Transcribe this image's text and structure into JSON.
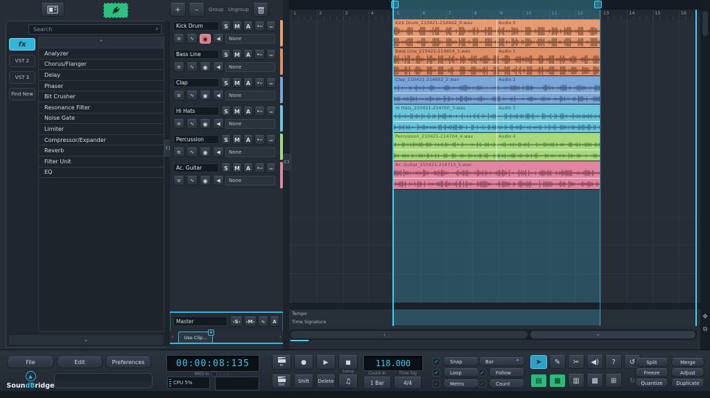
{
  "icons": {
    "search": "⌕",
    "chevron_up": "⌃",
    "chevron_down": "⌄",
    "gutter": "❮❯",
    "record": "●",
    "play": "▶",
    "stop": "■",
    "note": "♫",
    "undo": "↺",
    "redo": "↻",
    "left": "‹",
    "right": "›",
    "move": "✥",
    "copy": "⧉",
    "close": "×",
    "caret_up": "⌃",
    "dots": "•‒",
    "dash": "‒",
    "midi": "≡",
    "wave": "∿",
    "arm": "◉",
    "monitor": "◀",
    "check": "✓",
    "mountain": "▲"
  },
  "browser": {
    "search_placeholder": "Search",
    "tabs": [
      {
        "label": "fx",
        "active": true
      },
      {
        "label": "VST 2",
        "active": false
      },
      {
        "label": "VST 3",
        "active": false
      },
      {
        "label": "Find New",
        "active": false
      }
    ],
    "items": [
      "Analyzer",
      "Chorus/Flanger",
      "Delay",
      "Phaser",
      "Bit Crusher",
      "Resonance Filter",
      "Noise Gate",
      "Limiter",
      "Compressor/Expander",
      "Reverb",
      "Filter Unit",
      "EQ"
    ]
  },
  "tracks": {
    "add": "+",
    "remove": "–",
    "group": "Group",
    "ungroup": "Ungroup",
    "solo": "S",
    "mute": "M",
    "auto": "A",
    "input_value": "None",
    "list": [
      {
        "name": "Kick Drum",
        "color": "#e89a70",
        "armed": true
      },
      {
        "name": "Bass Line",
        "color": "#e08f66",
        "armed": false
      },
      {
        "name": "Clap",
        "color": "#7ca6d8",
        "armed": false
      },
      {
        "name": "Hi Hats",
        "color": "#6cc6de",
        "armed": false
      },
      {
        "name": "Percussion",
        "color": "#a6da7c",
        "armed": false
      },
      {
        "name": "Ac. Guitar",
        "color": "#e286a0",
        "armed": false
      }
    ],
    "master": {
      "name": "Master",
      "solo": "-S-",
      "mute": "-M-",
      "auto": "A"
    },
    "clip_tab": "Use Clip..."
  },
  "arrangement": {
    "bars": [
      "1",
      "2",
      "3",
      "4",
      "5",
      "6",
      "7",
      "8",
      "9",
      "10",
      "11",
      "12",
      "13",
      "14",
      "15",
      "16"
    ],
    "clips": [
      {
        "label": "Kick Drum_210421-214942_0.wav",
        "label2": "Audio 0",
        "color": "#e89a70",
        "wave": "#5a3326",
        "type": "kick",
        "single": false
      },
      {
        "label": "Bass Line_210421-214654_1.wav",
        "label2": "Audio 1",
        "color": "#e08f66",
        "wave": "#5a3326",
        "type": "bass",
        "single": false
      },
      {
        "label": "Clap_210421-214652_2.wav",
        "label2": "Audio 2",
        "color": "#7ca6d8",
        "wave": "#2e4160",
        "type": "clap",
        "single": false
      },
      {
        "label": "Hi Hats_210421-214700_3.wav",
        "label2": "Audio 3",
        "color": "#6cc6de",
        "wave": "#2d535f",
        "type": "hat",
        "single": false
      },
      {
        "label": "Percussion_210421-214704_4.wav",
        "label2": "Audio 4",
        "color": "#a6da7c",
        "wave": "#46602b",
        "type": "perc",
        "single": false
      },
      {
        "label": "Ac. Guitar_210421-214713_5.wav",
        "label2": "",
        "color": "#e286a0",
        "wave": "#6b2e40",
        "type": "guitar",
        "single": true
      }
    ],
    "lanes": [
      "Tempo",
      "Time Signature"
    ]
  },
  "transport": {
    "menu": [
      "File",
      "Edit",
      "Preferences"
    ],
    "logo_prefix": "Soun",
    "logo_accent": "dB",
    "logo_suffix": "ridge",
    "time_display": "00:00:08:135",
    "midi_in": "MIDI In",
    "cpu": "CPU 5%",
    "in_label": "In",
    "out_label": "Out",
    "shift": "Shift",
    "delete": "Delete",
    "swing": "Swing",
    "tempo": "118.000",
    "count_in_label": "Count-In",
    "count_in": "1 Bar",
    "time_sig_label": "Time Sig",
    "time_sig": "4/4",
    "toggles_left": [
      {
        "label": "Snap",
        "checked": true
      },
      {
        "label": "Loop",
        "checked": true
      },
      {
        "label": "Metro",
        "checked": false
      }
    ],
    "bar_mode": "Bar",
    "toggles_right": [
      {
        "label": "Follow",
        "checked": true
      },
      {
        "label": "Count",
        "checked": false
      }
    ],
    "tools_top": [
      {
        "name": "cursor-tool",
        "glyph": "➤",
        "active": true,
        "green": false,
        "dim": false
      },
      {
        "name": "pencil-tool",
        "glyph": "✎",
        "active": false,
        "green": false,
        "dim": false
      },
      {
        "name": "scissors-tool",
        "glyph": "✂",
        "active": false,
        "green": false,
        "dim": false
      },
      {
        "name": "audition-tool",
        "glyph": "◀)",
        "active": false,
        "green": false,
        "dim": false
      },
      {
        "name": "help-button",
        "glyph": "?",
        "active": false,
        "green": false,
        "dim": false
      },
      {
        "name": "undo-button",
        "glyph": "↺",
        "active": false,
        "green": false,
        "dim": false
      }
    ],
    "tools_bottom": [
      {
        "name": "piano-roll-button",
        "glyph": "▤",
        "active": false,
        "green": true,
        "dim": false
      },
      {
        "name": "step-sequencer-button",
        "glyph": "▦",
        "active": false,
        "green": true,
        "dim": false
      },
      {
        "name": "mixer-button",
        "glyph": "▥",
        "active": false,
        "green": false,
        "dim": false
      },
      {
        "name": "keyboard-button",
        "glyph": "▩",
        "active": false,
        "green": false,
        "dim": false
      },
      {
        "name": "export-button",
        "glyph": "⊞",
        "active": false,
        "green": false,
        "dim": false
      },
      {
        "name": "redo-button",
        "glyph": "↻",
        "active": false,
        "green": false,
        "dim": true
      }
    ],
    "actions": [
      "Split",
      "Merge",
      "Freeze",
      "Adjust",
      "Quantize",
      "Duplicate"
    ],
    "accent_color": "#3fc6ee"
  }
}
